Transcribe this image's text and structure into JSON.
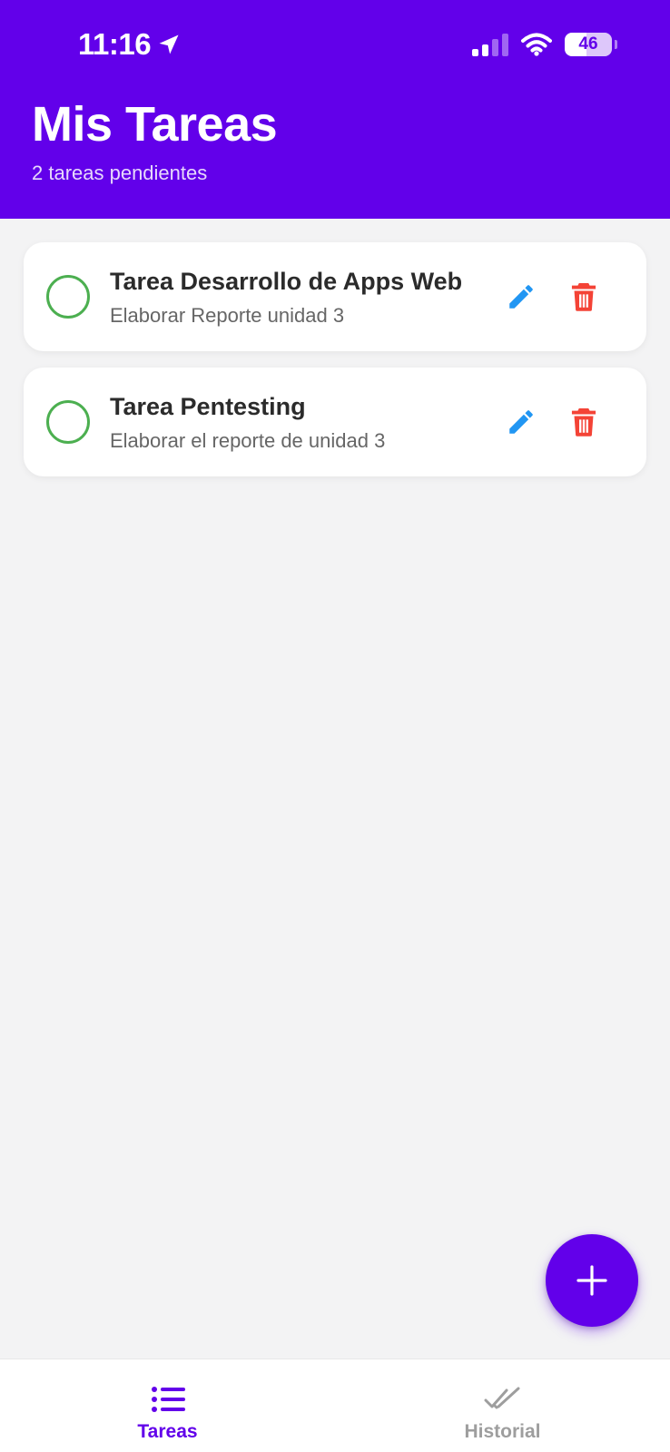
{
  "status_bar": {
    "time": "11:16",
    "battery": "46"
  },
  "header": {
    "title": "Mis Tareas",
    "subtitle": "2 tareas pendientes"
  },
  "tasks": [
    {
      "title": "Tarea Desarrollo de Apps Web",
      "description": "Elaborar Reporte unidad 3"
    },
    {
      "title": "Tarea Pentesting",
      "description": "Elaborar el reporte de unidad 3"
    }
  ],
  "bottom_nav": {
    "items": [
      {
        "label": "Tareas",
        "icon": "list-icon",
        "active": true
      },
      {
        "label": "Historial",
        "icon": "double-check-icon",
        "active": false
      }
    ]
  },
  "colors": {
    "primary": "#6200ea",
    "check_outline": "#4caf50",
    "edit": "#2196f3",
    "delete": "#f44336",
    "inactive_nav": "#9e9e9e"
  }
}
